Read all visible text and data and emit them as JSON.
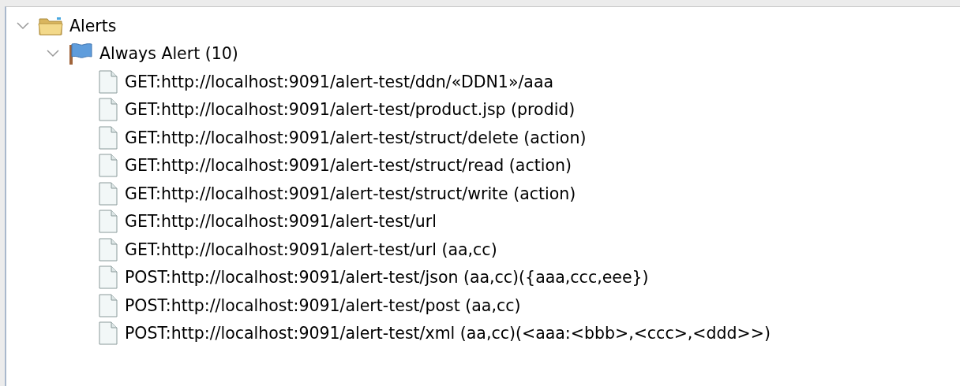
{
  "tree": [
    {
      "kind": "folder",
      "label": "Alerts",
      "expanded": true,
      "children": [
        {
          "kind": "flag",
          "label": "Always Alert (10)",
          "expanded": true,
          "children": [
            {
              "kind": "file",
              "label": "GET:http://localhost:9091/alert-test/ddn/«DDN1»/aaa"
            },
            {
              "kind": "file",
              "label": "GET:http://localhost:9091/alert-test/product.jsp (prodid)"
            },
            {
              "kind": "file",
              "label": "GET:http://localhost:9091/alert-test/struct/delete (action)"
            },
            {
              "kind": "file",
              "label": "GET:http://localhost:9091/alert-test/struct/read (action)"
            },
            {
              "kind": "file",
              "label": "GET:http://localhost:9091/alert-test/struct/write (action)"
            },
            {
              "kind": "file",
              "label": "GET:http://localhost:9091/alert-test/url"
            },
            {
              "kind": "file",
              "label": "GET:http://localhost:9091/alert-test/url (aa,cc)"
            },
            {
              "kind": "file",
              "label": "POST:http://localhost:9091/alert-test/json (aa,cc)({aaa,ccc,eee})"
            },
            {
              "kind": "file",
              "label": "POST:http://localhost:9091/alert-test/post (aa,cc)"
            },
            {
              "kind": "file",
              "label": "POST:http://localhost:9091/alert-test/xml (aa,cc)(<aaa:<bbb>,<ccc>,<ddd>>)"
            }
          ]
        }
      ]
    }
  ]
}
